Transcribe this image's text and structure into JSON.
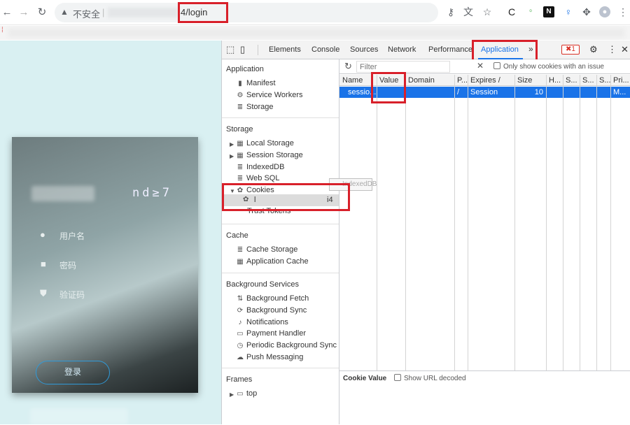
{
  "browser": {
    "security_label": "不安全",
    "url_suffix": "4/login",
    "bookmark_bar": ""
  },
  "page": {
    "login": {
      "username_label": "用户名",
      "password_label": "密码",
      "captcha_label": "验证码",
      "captcha_text": "nd≥7",
      "login_button": "登录"
    }
  },
  "devtools": {
    "tabs": [
      "Elements",
      "Console",
      "Sources",
      "Network",
      "Performance",
      "Application"
    ],
    "active_tab": "Application",
    "more_tabs": "»",
    "error_count": "1",
    "sidebar": {
      "application_header": "Application",
      "application_items": [
        "Manifest",
        "Service Workers",
        "Storage"
      ],
      "storage_header": "Storage",
      "storage_items": [
        "Local Storage",
        "Session Storage",
        "IndexedDB",
        "Web SQL",
        "Cookies"
      ],
      "cookie_child": "l",
      "cookie_child_suffix": "i4",
      "trust_tokens": "Trust Tokens",
      "tooltip": "IndexedDB",
      "cache_header": "Cache",
      "cache_items": [
        "Cache Storage",
        "Application Cache"
      ],
      "bg_header": "Background Services",
      "bg_items": [
        "Background Fetch",
        "Background Sync",
        "Notifications",
        "Payment Handler",
        "Periodic Background Sync",
        "Push Messaging"
      ],
      "frames_header": "Frames",
      "frames_item": "top"
    },
    "filter": {
      "placeholder": "Filter",
      "issue_label": "Only show cookies with an issue"
    },
    "table": {
      "columns": [
        "Name",
        "Value",
        "Domain",
        "P...",
        "Expires / M...",
        "Size",
        "H...",
        "S...",
        "S...",
        "S...",
        "Pri..."
      ],
      "row": {
        "name": "sessio...",
        "value": "",
        "domain": "",
        "path": "/",
        "expires": "Session",
        "size": "10",
        "priority": "M..."
      }
    },
    "cookie_value": {
      "label": "Cookie Value",
      "decode_label": "Show URL decoded"
    }
  },
  "colors": {
    "highlight": "#d8202a",
    "selection": "#1a73e8",
    "page_bg": "#d9f0f2"
  }
}
